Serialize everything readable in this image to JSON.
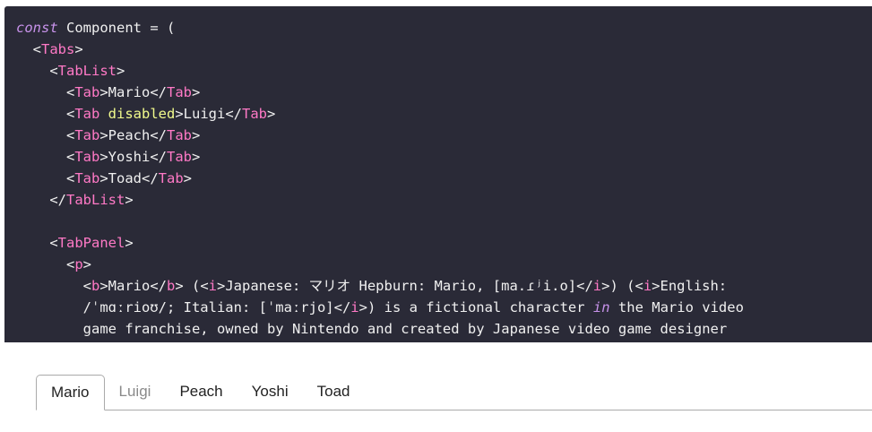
{
  "code": {
    "lines": [
      [
        {
          "t": "const",
          "c": "kw"
        },
        {
          "t": " Component = ("
        }
      ],
      [
        {
          "t": "  <"
        },
        {
          "t": "Tabs",
          "c": "tag"
        },
        {
          "t": ">"
        }
      ],
      [
        {
          "t": "    <"
        },
        {
          "t": "TabList",
          "c": "tag"
        },
        {
          "t": ">"
        }
      ],
      [
        {
          "t": "      <"
        },
        {
          "t": "Tab",
          "c": "tag"
        },
        {
          "t": ">Mario</"
        },
        {
          "t": "Tab",
          "c": "tag"
        },
        {
          "t": ">"
        }
      ],
      [
        {
          "t": "      <"
        },
        {
          "t": "Tab",
          "c": "tag"
        },
        {
          "t": " "
        },
        {
          "t": "disabled",
          "c": "attr"
        },
        {
          "t": ">Luigi</"
        },
        {
          "t": "Tab",
          "c": "tag"
        },
        {
          "t": ">"
        }
      ],
      [
        {
          "t": "      <"
        },
        {
          "t": "Tab",
          "c": "tag"
        },
        {
          "t": ">Peach</"
        },
        {
          "t": "Tab",
          "c": "tag"
        },
        {
          "t": ">"
        }
      ],
      [
        {
          "t": "      <"
        },
        {
          "t": "Tab",
          "c": "tag"
        },
        {
          "t": ">Yoshi</"
        },
        {
          "t": "Tab",
          "c": "tag"
        },
        {
          "t": ">"
        }
      ],
      [
        {
          "t": "      <"
        },
        {
          "t": "Tab",
          "c": "tag"
        },
        {
          "t": ">Toad</"
        },
        {
          "t": "Tab",
          "c": "tag"
        },
        {
          "t": ">"
        }
      ],
      [
        {
          "t": "    </"
        },
        {
          "t": "TabList",
          "c": "tag"
        },
        {
          "t": ">"
        }
      ],
      [
        {
          "t": ""
        }
      ],
      [
        {
          "t": "    <"
        },
        {
          "t": "TabPanel",
          "c": "tag"
        },
        {
          "t": ">"
        }
      ],
      [
        {
          "t": "      <"
        },
        {
          "t": "p",
          "c": "tag"
        },
        {
          "t": ">"
        }
      ],
      [
        {
          "t": "        <"
        },
        {
          "t": "b",
          "c": "tag"
        },
        {
          "t": ">Mario</"
        },
        {
          "t": "b",
          "c": "tag"
        },
        {
          "t": "> (<"
        },
        {
          "t": "i",
          "c": "tag"
        },
        {
          "t": ">Japanese: マリオ Hepburn: Mario, [ma.ɾʲi.o]</"
        },
        {
          "t": "i",
          "c": "tag"
        },
        {
          "t": ">) (<"
        },
        {
          "t": "i",
          "c": "tag"
        },
        {
          "t": ">English:"
        }
      ],
      [
        {
          "t": "        /ˈmɑːrioʊ/; Italian: [ˈmaːrjo]</"
        },
        {
          "t": "i",
          "c": "tag"
        },
        {
          "t": ">) is a fictional character "
        },
        {
          "t": "in",
          "c": "kw"
        },
        {
          "t": " the Mario video"
        }
      ],
      [
        {
          "t": "        game franchise, owned by Nintendo and created by Japanese video game designer"
        }
      ]
    ]
  },
  "tabs": [
    {
      "label": "Mario",
      "selected": true,
      "disabled": false
    },
    {
      "label": "Luigi",
      "selected": false,
      "disabled": true
    },
    {
      "label": "Peach",
      "selected": false,
      "disabled": false
    },
    {
      "label": "Yoshi",
      "selected": false,
      "disabled": false
    },
    {
      "label": "Toad",
      "selected": false,
      "disabled": false
    }
  ],
  "colors": {
    "code_background": "#2a2a37",
    "keyword": "#c792ea",
    "tag": "#ff79c6",
    "attribute": "#f1fa8c",
    "code_text": "#f0f0f0"
  }
}
